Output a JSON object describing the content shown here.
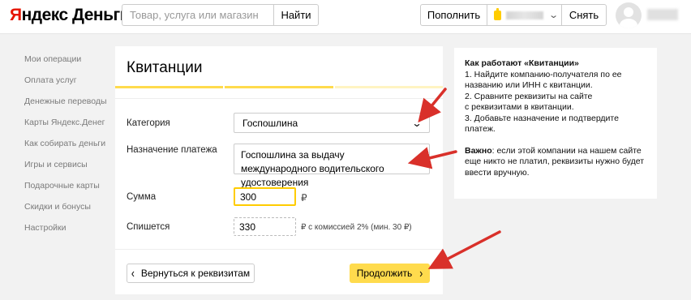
{
  "header": {
    "logo_part1": "Я",
    "logo_part2": "ндекс Деньги",
    "search_placeholder": "Товар, услуга или магазин",
    "search_button": "Найти",
    "topup_button": "Пополнить",
    "withdraw_button": "Снять"
  },
  "sidebar": {
    "items": [
      {
        "label": "Мои операции"
      },
      {
        "label": "Оплата услуг"
      },
      {
        "label": "Денежные переводы"
      },
      {
        "label": "Карты Яндекс.Денег"
      },
      {
        "label": "Как собирать деньги"
      },
      {
        "label": "Игры и сервисы"
      },
      {
        "label": "Подарочные карты"
      },
      {
        "label": "Скидки и бонусы"
      },
      {
        "label": "Настройки"
      }
    ]
  },
  "main": {
    "title": "Квитанции",
    "progress": {
      "steps_total": 3,
      "steps_active": 2
    },
    "category_label": "Категория",
    "category_value": "Госпошлина",
    "purpose_label": "Назначение платежа",
    "purpose_value": "Госпошлина за выдачу международного водительского удостоверения",
    "sum_label": "Сумма",
    "sum_value": "300",
    "currency": "₽",
    "charge_label": "Спишется",
    "charge_value": "330",
    "commission_text": "₽ с комиссией 2% (мин. 30 ₽)",
    "back_button": "Вернуться к реквизитам",
    "continue_button": "Продолжить"
  },
  "info": {
    "title": "Как работают «Квитанции»",
    "lines": [
      "1. Найдите компанию-получателя по ее",
      "названию или ИНН с квитанции.",
      "2. Сравните реквизиты на сайте",
      "с реквизитами в квитанции.",
      "3. Добавьте назначение и подтвердите",
      "платеж."
    ],
    "note_bold": "Важно",
    "note_lines": [
      ": если этой компании на нашем сайте",
      "еще никто не платил, реквизиты нужно будет",
      "ввести вручную."
    ]
  },
  "colors": {
    "accent_yellow": "#ffdb4d",
    "logo_red": "#e61400",
    "annotation_red": "#d9302a"
  }
}
